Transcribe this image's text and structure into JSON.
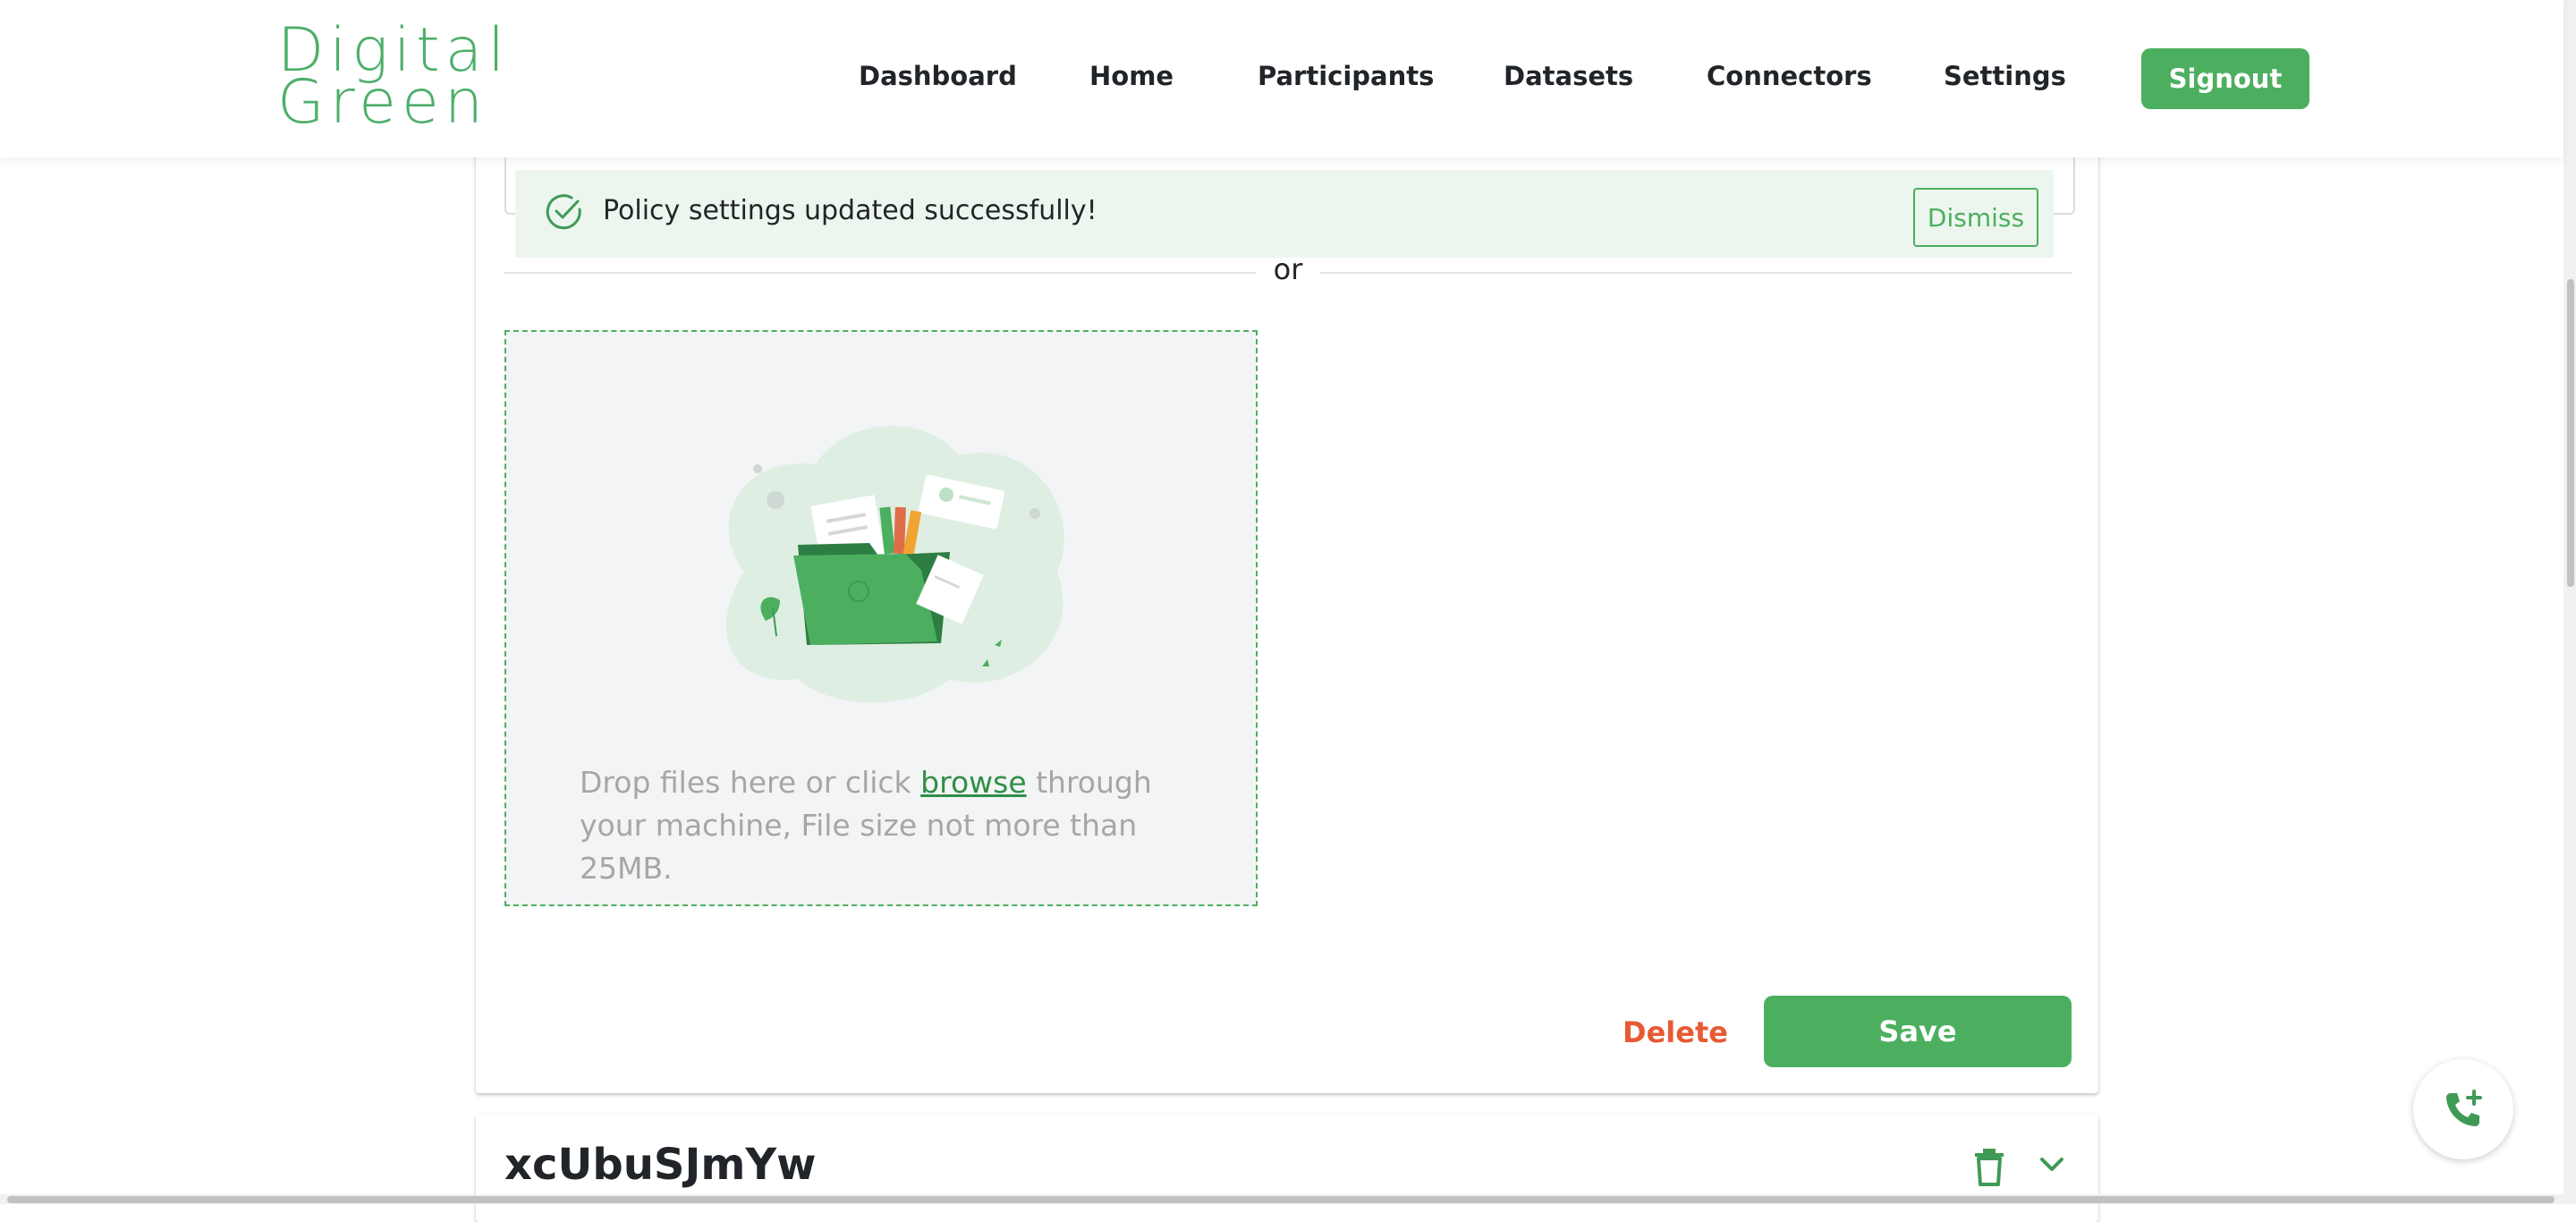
{
  "brand": {
    "logo_line1": "Digital",
    "logo_line2": "Green",
    "color": "#4caf6a"
  },
  "nav": {
    "items": [
      {
        "label": "Dashboard"
      },
      {
        "label": "Home"
      },
      {
        "label": "Participants"
      },
      {
        "label": "Datasets"
      },
      {
        "label": "Connectors"
      },
      {
        "label": "Settings"
      }
    ],
    "signout_label": "Signout"
  },
  "alert": {
    "message": "Policy settings updated successfully!",
    "dismiss_label": "Dismiss",
    "icon": "check-circle-icon"
  },
  "divider": {
    "or_label": "or"
  },
  "upload": {
    "text_before": "Drop files here or click ",
    "browse_label": "browse",
    "text_after": " through your machine, File size not more than 25MB.",
    "illustration": "folder-illustration"
  },
  "actions": {
    "delete_label": "Delete",
    "save_label": "Save"
  },
  "next_policy": {
    "title": "xcUbuSJmYw",
    "icons": [
      "trash-icon",
      "chevron-down-icon"
    ]
  },
  "fab": {
    "icon": "phone-add-icon"
  },
  "colors": {
    "accent": "#4caf5f",
    "danger": "#e75a34",
    "alert_bg": "#ecf6ee"
  }
}
